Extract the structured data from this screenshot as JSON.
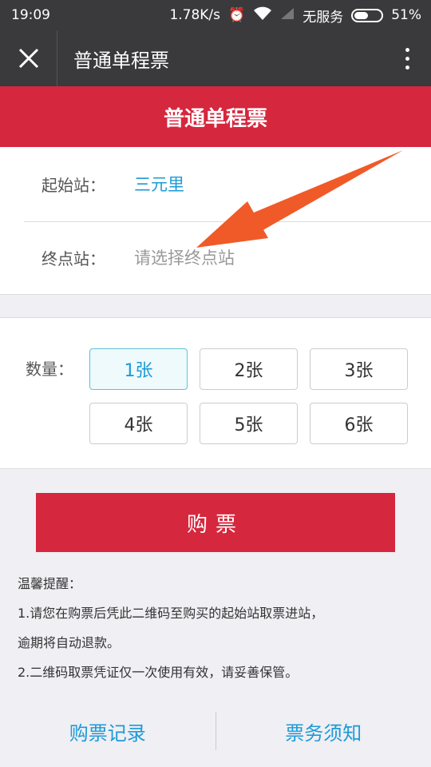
{
  "status_bar": {
    "time": "19:09",
    "speed": "1.78K/s",
    "carrier": "无服务",
    "battery": "51%",
    "battery_level": 0.51
  },
  "titlebar": {
    "title": "普通单程票",
    "close_icon": "close-icon",
    "more_icon": "more-vertical-icon"
  },
  "header": {
    "title": "普通单程票"
  },
  "start": {
    "label": "起始站：",
    "value": "三元里"
  },
  "end": {
    "label": "终点站：",
    "placeholder": "请选择终点站"
  },
  "quantity": {
    "label": "数量：",
    "options": [
      "1张",
      "2张",
      "3张",
      "4张",
      "5张",
      "6张"
    ],
    "selected": "1张"
  },
  "buy_button": "购票",
  "notice": {
    "title": "温馨提醒：",
    "line1": "1.请您在购票后凭此二维码至购买的起始站取票进站，",
    "line2": "逾期将自动退款。",
    "line3": "2.二维码取票凭证仅一次使用有效，请妥善保管。"
  },
  "bottom_nav": {
    "left": "购票记录",
    "right": "票务须知"
  },
  "colors": {
    "accent_red": "#d5273d",
    "link_blue": "#1e9ad6",
    "arrow": "#f05a28"
  }
}
